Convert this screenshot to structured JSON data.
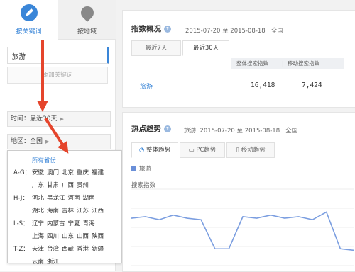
{
  "sidebar": {
    "tabs": [
      {
        "label": "按关键词",
        "icon": "pen-icon",
        "active": true
      },
      {
        "label": "按地域",
        "icon": "map-pin-icon",
        "active": false
      }
    ],
    "keyword": "旅游",
    "add_keyword_label": "添加关键词",
    "time_label": "时间：最近30天",
    "region_label": "地区：全国",
    "region_dropdown": {
      "all_label": "所有省份",
      "groups": [
        {
          "label": "A-G：",
          "rows": [
            [
              "安徽",
              "澳门",
              "北京",
              "重庆",
              "福建"
            ],
            [
              "广东",
              "甘肃",
              "广西",
              "贵州"
            ]
          ]
        },
        {
          "label": "H-J：",
          "rows": [
            [
              "河北",
              "黑龙江",
              "河南",
              "湖南"
            ],
            [
              "湖北",
              "海南",
              "吉林",
              "江苏",
              "江西"
            ]
          ]
        },
        {
          "label": "L-S：",
          "rows": [
            [
              "辽宁",
              "内蒙古",
              "宁夏",
              "青海"
            ],
            [
              "上海",
              "四川",
              "山东",
              "山西",
              "陕西"
            ]
          ]
        },
        {
          "label": "T-Z：",
          "rows": [
            [
              "天津",
              "台湾",
              "西藏",
              "香港",
              "新疆"
            ],
            [
              "云南",
              "浙江"
            ]
          ]
        }
      ]
    }
  },
  "overview": {
    "title": "指数概况",
    "date_range": "2015-07-20 至 2015-08-18",
    "region": "全国",
    "tabs": [
      "最近7天",
      "最近30天"
    ],
    "active_tab": 1,
    "columns": [
      "整体搜索指数",
      "移动搜索指数"
    ],
    "rows": [
      {
        "keyword": "旅游",
        "overall": "16,418",
        "mobile": "7,424"
      }
    ]
  },
  "trend": {
    "title": "热点趋势",
    "keyword": "旅游",
    "date_range": "2015-07-20 至 2015-08-18",
    "region": "全国",
    "tabs": [
      "整体趋势",
      "PC趋势",
      "移动趋势"
    ],
    "active_tab": 0
  },
  "chart_data": {
    "type": "line",
    "title": "",
    "xlabel": "",
    "ylabel": "搜索指数",
    "series": [
      {
        "name": "旅游",
        "values": [
          0.62,
          0.64,
          0.6,
          0.66,
          0.62,
          0.6,
          0.22,
          0.22,
          0.64,
          0.62,
          0.66,
          0.62,
          0.64,
          0.6,
          0.7,
          0.22,
          0.2
        ]
      }
    ],
    "legend": "top-left",
    "color": "#7b9ee0"
  },
  "colors": {
    "accent": "#3a86d8",
    "arrow": "#e5452c",
    "line": "#7b9ee0"
  }
}
